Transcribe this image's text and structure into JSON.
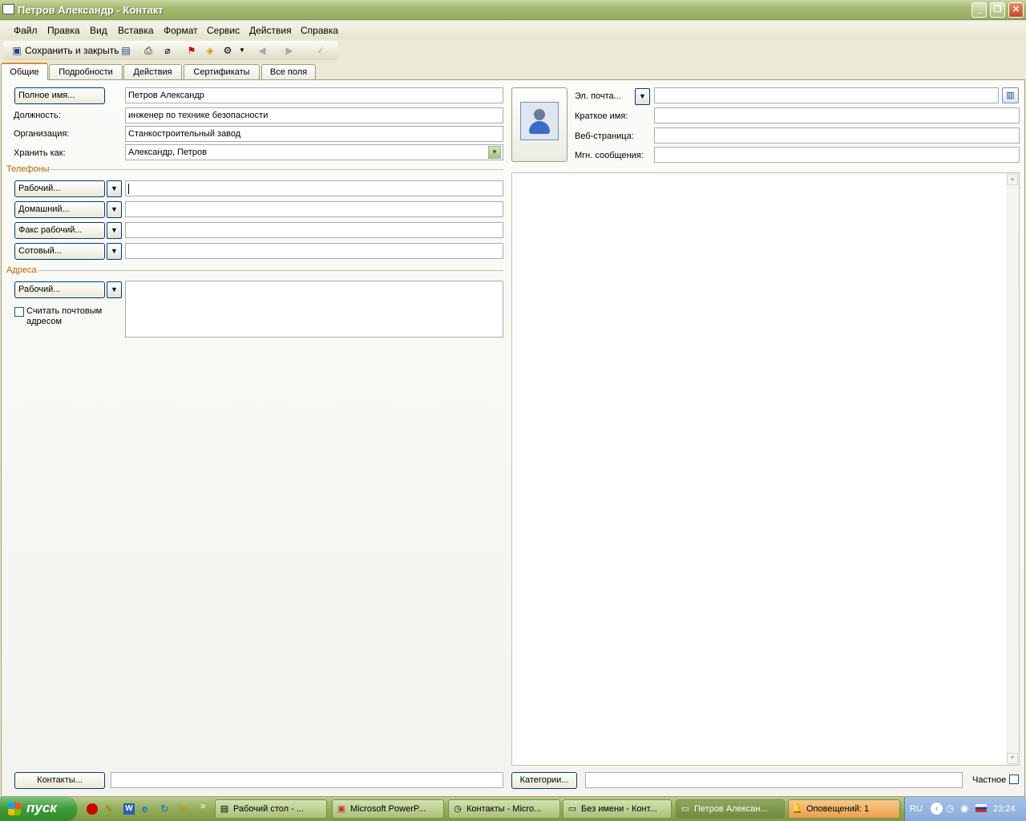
{
  "window": {
    "title": "Петров Александр - Контакт"
  },
  "menu": [
    "Файл",
    "Правка",
    "Вид",
    "Вставка",
    "Формат",
    "Сервис",
    "Действия",
    "Справка"
  ],
  "toolbar": {
    "save_close": "Сохранить и закрыть"
  },
  "tabs": [
    "Общие",
    "Подробности",
    "Действия",
    "Сертификаты",
    "Все поля"
  ],
  "form": {
    "fullname_btn": "Полное имя...",
    "fullname": "Петров Александр",
    "position_label": "Должность:",
    "position": "инженер по технике безопасности",
    "org_label": "Организация:",
    "org": "Станкостроительный завод",
    "fileas_label": "Хранить как:",
    "fileas": "Александр, Петров",
    "phones_label": "Телефоны",
    "phone_btns": [
      "Рабочий...",
      "Домашний...",
      "Факс рабочий...",
      "Сотовый..."
    ],
    "addresses_label": "Адреса",
    "address_btn": "Рабочий...",
    "mailing_checkbox": "Считать почтовым",
    "mailing_checkbox2": "адресом",
    "email_label": "Эл. почта...",
    "shortname_label": "Краткое имя:",
    "web_label": "Веб-страница:",
    "im_label": "Мгн. сообщения:",
    "contacts_btn": "Контакты...",
    "categories_btn": "Категории...",
    "private_label": "Частное"
  },
  "taskbar": {
    "start": "пуск",
    "tasks": [
      "Рабочий стол - ...",
      "Microsoft PowerP...",
      "Контакты - Micro...",
      "Без имени - Конт...",
      "Петров Алексан...",
      "Оповещений: 1"
    ],
    "lang": "RU",
    "clock": "23:24"
  }
}
